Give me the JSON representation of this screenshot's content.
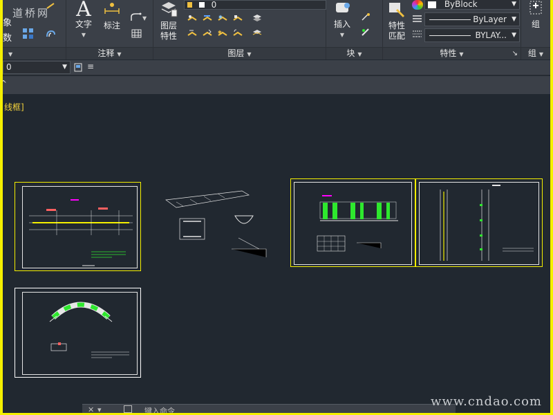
{
  "watermark_top": "道桥网",
  "watermark_bottom": "www.cndao.com",
  "ribbon": {
    "modify_partial": "象",
    "modify_partial2": "数",
    "annotation": {
      "text_label": "文字",
      "dim_label": "标注",
      "panel_label": "注释"
    },
    "layers": {
      "layer_props_label_line1": "图层",
      "layer_props_label_line2": "特性",
      "layer_value": "0",
      "panel_label": "图层"
    },
    "block": {
      "insert_label": "插入",
      "panel_label": "块"
    },
    "properties": {
      "match_label_line1": "特性",
      "match_label_line2": "匹配",
      "color_value": "ByBlock",
      "linetype_value": "ByLayer",
      "lineweight_value": "BYLAY...",
      "panel_label": "特性",
      "launcher": "↘"
    },
    "group": {
      "group_label": "组",
      "panel_label": "组"
    }
  },
  "bar2": {
    "combo_value": "0"
  },
  "viewport_label": "线框]",
  "command": {
    "placeholder": "键入命令"
  },
  "colors": {
    "workspace_bg": "#212830",
    "ribbon_bg": "#3b4048",
    "highlight_border": "#f5f000",
    "accent_green": "#2ee82e",
    "accent_magenta": "#ff00ff"
  }
}
